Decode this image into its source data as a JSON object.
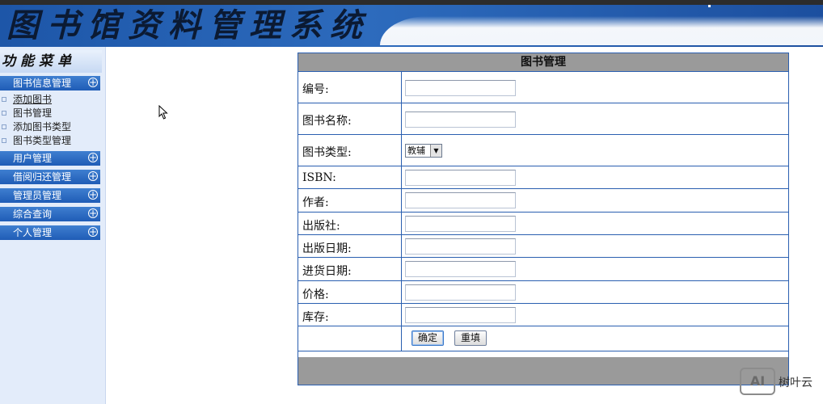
{
  "header": {
    "system_name": "图书馆资料管理系统"
  },
  "sidebar": {
    "title": "功能菜单",
    "groups": [
      {
        "label": "图书信息管理"
      },
      {
        "label": "用户管理"
      },
      {
        "label": "借阅归还管理"
      },
      {
        "label": "管理员管理"
      },
      {
        "label": "综合查询"
      },
      {
        "label": "个人管理"
      }
    ],
    "sub_items": [
      {
        "label": "添加图书"
      },
      {
        "label": "图书管理"
      },
      {
        "label": "添加图书类型"
      },
      {
        "label": "图书类型管理"
      }
    ],
    "expand_symbol": "+"
  },
  "form": {
    "title": "图书管理",
    "fields": {
      "id": {
        "label": "编号:",
        "value": ""
      },
      "name": {
        "label": "图书名称:",
        "value": ""
      },
      "type": {
        "label": "图书类型:",
        "value": "教辅"
      },
      "isbn": {
        "label": "ISBN:",
        "value": ""
      },
      "author": {
        "label": "作者:",
        "value": ""
      },
      "publisher": {
        "label": "出版社:",
        "value": ""
      },
      "pub_date": {
        "label": "出版日期:",
        "value": ""
      },
      "stock_date": {
        "label": "进货日期:",
        "value": ""
      },
      "price": {
        "label": "价格:",
        "value": ""
      },
      "stock": {
        "label": "库存:",
        "value": ""
      }
    },
    "buttons": {
      "confirm": "确定",
      "reset": "重填"
    }
  },
  "watermark": {
    "logo": "AI",
    "brand": "树叶云"
  },
  "colors": {
    "banner": "#1d56a8",
    "sidebar_bg": "#e3ecfa",
    "table_border": "#2a5fb0",
    "header_gray": "#9a9a9a"
  }
}
